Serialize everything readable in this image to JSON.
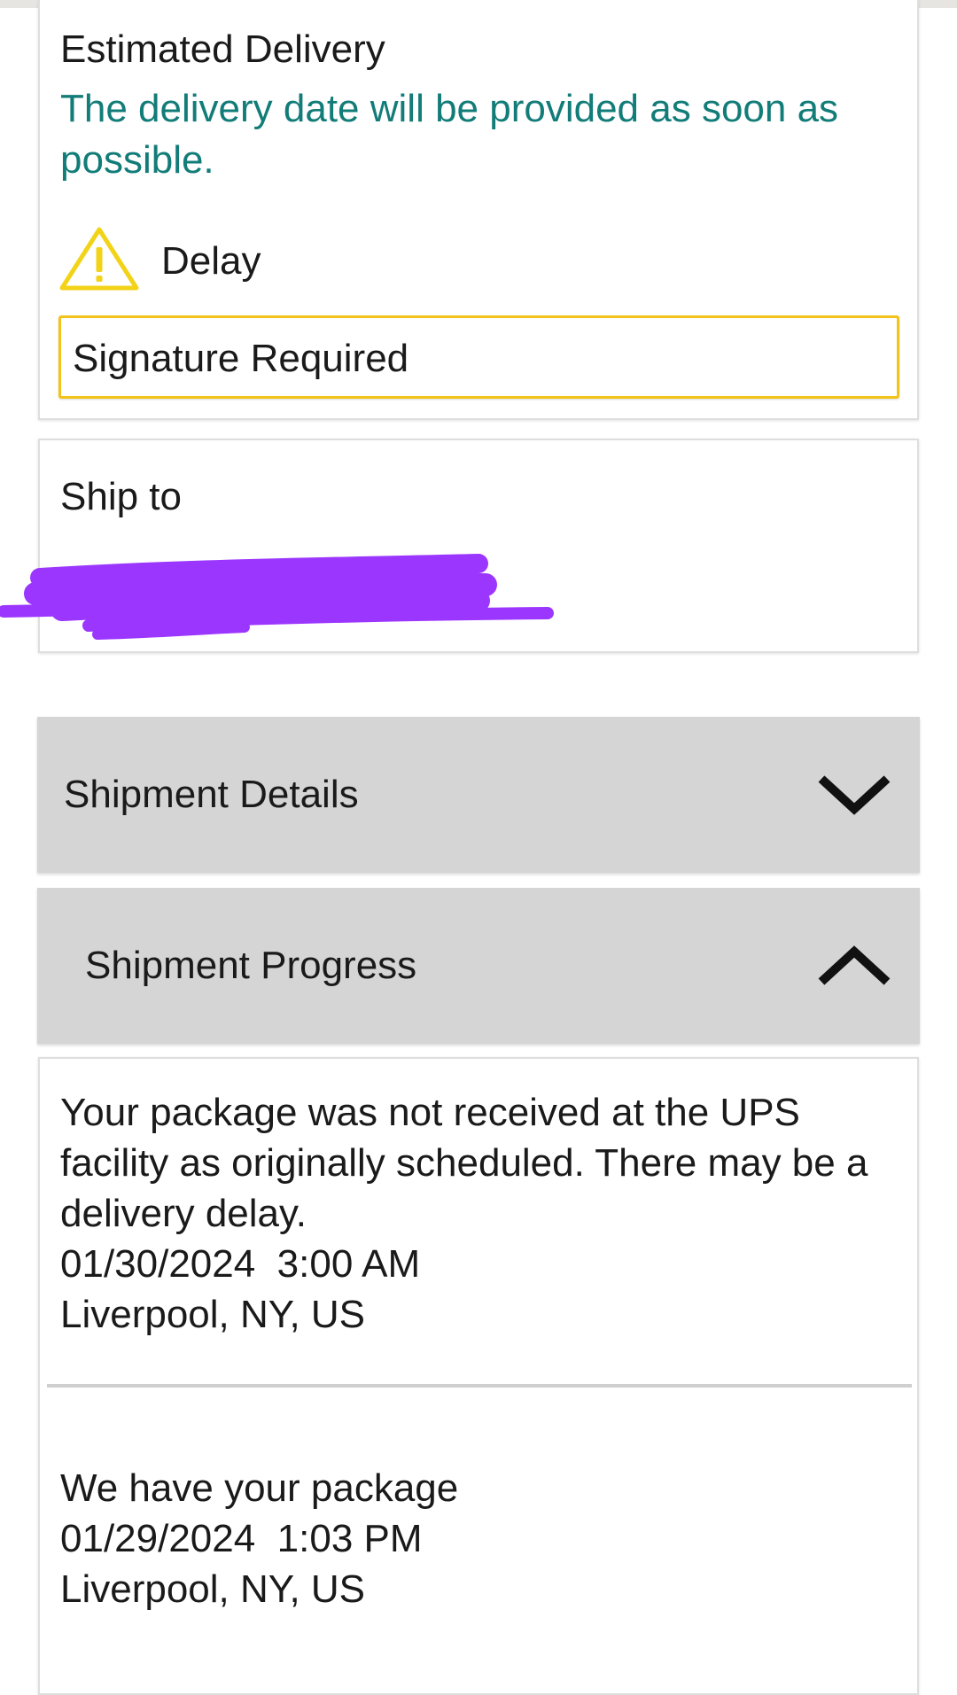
{
  "estimated_delivery": {
    "label": "Estimated Delivery",
    "message": "The delivery date will be provided as soon as possible.",
    "message_color": "#127c78",
    "status_icon": "warning-triangle-icon",
    "status_icon_color": "#f2d318",
    "status_label": "Delay",
    "notice": "Signature Required",
    "notice_border_color": "#f2c318"
  },
  "ship_to": {
    "label": "Ship to",
    "redaction_color": "#9b36ff"
  },
  "sections": {
    "details": {
      "label": "Shipment Details",
      "icon": "chevron-down-icon",
      "expanded": false
    },
    "progress": {
      "label": "Shipment Progress",
      "icon": "chevron-up-icon",
      "expanded": true
    }
  },
  "progress_events": [
    {
      "description": "Your package was not received at the UPS facility as originally scheduled. There may be a delivery delay.",
      "date": "01/30/2024",
      "time": "3:00 AM",
      "location": "Liverpool, NY, US"
    },
    {
      "description": "We have your package",
      "date": "01/29/2024",
      "time": "1:03 PM",
      "location": "Liverpool, NY, US"
    }
  ]
}
